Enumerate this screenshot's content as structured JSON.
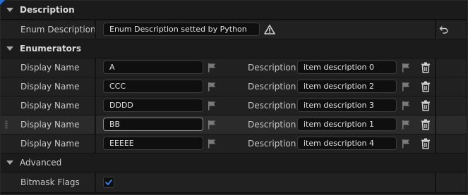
{
  "description_section": {
    "title": "Description",
    "enum_description": {
      "label": "Enum Description",
      "value": "Enum Description setted by Python"
    }
  },
  "enumerators_section": {
    "title": "Enumerators",
    "display_label": "Display Name",
    "description_label": "Description",
    "items": [
      {
        "display_name": "A",
        "description": "item description 0"
      },
      {
        "display_name": "CCC",
        "description": "item description 2"
      },
      {
        "display_name": "DDDD",
        "description": "item description 3"
      },
      {
        "display_name": "BB",
        "description": "item description 1"
      },
      {
        "display_name": "EEEEE",
        "description": "item description 4"
      }
    ]
  },
  "advanced_section": {
    "title": "Advanced",
    "bitmask_flags": {
      "label": "Bitmask Flags",
      "checked": true
    }
  },
  "colors": {
    "accent": "#2b6fd6",
    "checkmark": "#3d8bff",
    "warning": "#d0d0d0"
  },
  "icons": {
    "expand": "triangle-down-icon",
    "warning": "warning-icon",
    "reset": "reset-arrow-icon",
    "flag": "flag-icon",
    "delete": "trash-icon",
    "checkbox": "checkmark-icon",
    "drag": "drag-grip-icon"
  }
}
